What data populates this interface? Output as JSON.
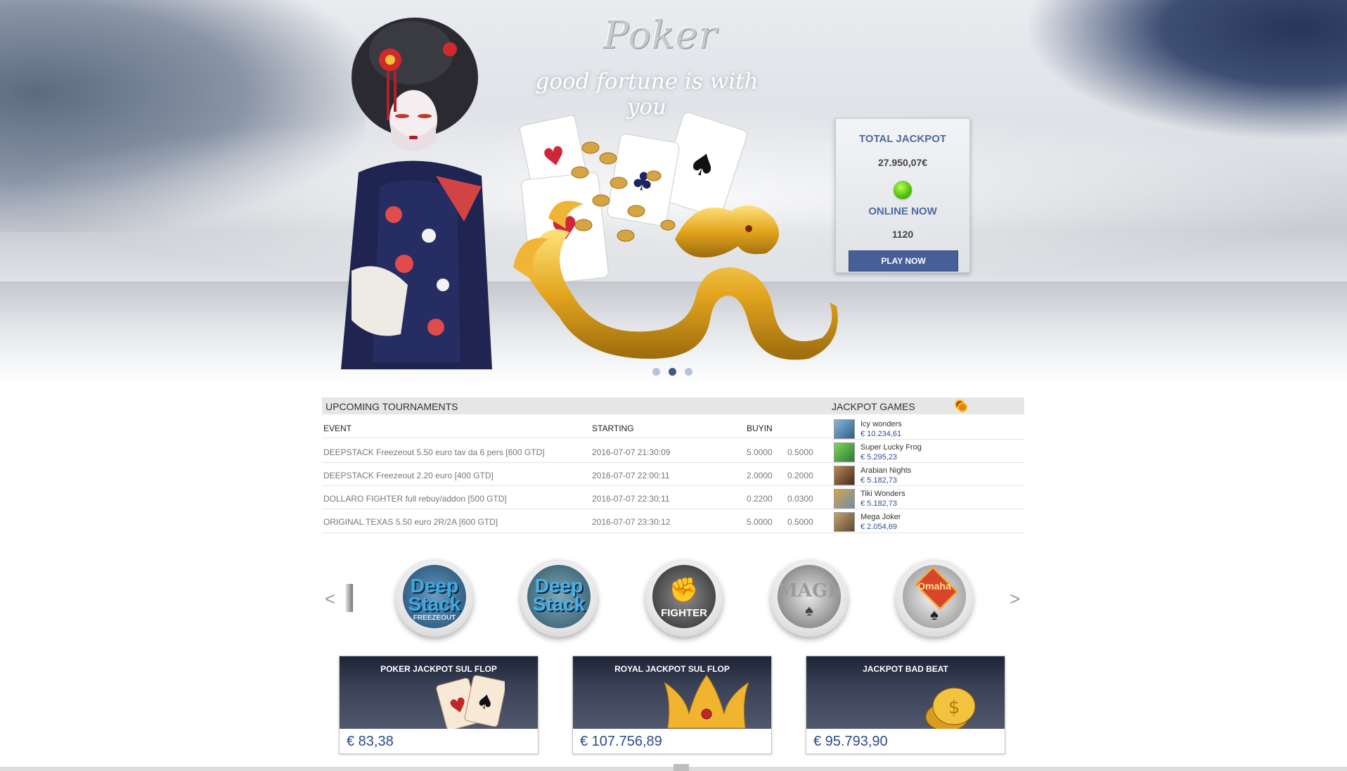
{
  "hero": {
    "title": "Poker",
    "tagline": "good fortune is with you",
    "jackpot_label": "TOTAL JACKPOT",
    "jackpot_value": "27.950,07€",
    "online_label": "ONLINE NOW",
    "online_value": "1120",
    "play_label": "PLAY NOW",
    "slides": 3,
    "active_slide": 2
  },
  "tournaments": {
    "heading": "UPCOMING TOURNAMENTS",
    "columns": [
      "EVENT",
      "STARTING",
      "BUYIN"
    ],
    "rows": [
      {
        "event": "DEEPSTACK Freezeout 5.50 euro tav da 6 pers [600 GTD]",
        "starting": "2016-07-07 21:30:09",
        "buyin": "5.0000",
        "fee": "0.5000"
      },
      {
        "event": "DEEPSTACK Freezeout 2.20 euro [400 GTD]",
        "starting": "2016-07-07 22:00:11",
        "buyin": "2.0000",
        "fee": "0.2000"
      },
      {
        "event": "DOLLARO FIGHTER full rebuy/addon [500 GTD]",
        "starting": "2016-07-07 22:30:11",
        "buyin": "0.2200",
        "fee": "0.0300"
      },
      {
        "event": "ORIGINAL TEXAS 5.50 euro 2R/2A [600 GTD]",
        "starting": "2016-07-07 23:30:12",
        "buyin": "5.0000",
        "fee": "0.5000"
      }
    ]
  },
  "jackpot_games": {
    "heading": "JACKPOT GAMES",
    "items": [
      {
        "name": "Icy wonders",
        "value": "€ 10.234,61"
      },
      {
        "name": "Super Lucky Frog",
        "value": "€ 5.295,23"
      },
      {
        "name": "Arabian Nights",
        "value": "€ 5.182,73"
      },
      {
        "name": "Tiki Wonders",
        "value": "€ 5.182,73"
      },
      {
        "name": "Mega Joker",
        "value": "€ 2.054,69"
      }
    ]
  },
  "badges": {
    "prev": "<",
    "next": ">",
    "items": [
      {
        "line1": "Deep",
        "line2": "Stack",
        "line3": "FREEZEOUT"
      },
      {
        "line1": "Deep",
        "line2": "Stack",
        "line3": ""
      },
      {
        "line1": "FIGHTER",
        "line2": "",
        "line3": ""
      },
      {
        "line1": "MAGIC",
        "line2": "",
        "line3": ""
      },
      {
        "line1": "Omaha",
        "line2": "",
        "line3": ""
      }
    ]
  },
  "jackpot_cards": [
    {
      "title": "POKER JACKPOT SUL FLOP",
      "amount": "€  83,38"
    },
    {
      "title": "ROYAL JACKPOT SUL FLOP",
      "amount": "€  107.756,89"
    },
    {
      "title": "JACKPOT BAD BEAT",
      "amount": "€  95.793,90"
    }
  ],
  "colors": {
    "accent_blue": "#465f99",
    "label_blue": "#4d6aa1",
    "online_green": "#55c60a",
    "amount_blue": "#2c4a8a"
  }
}
